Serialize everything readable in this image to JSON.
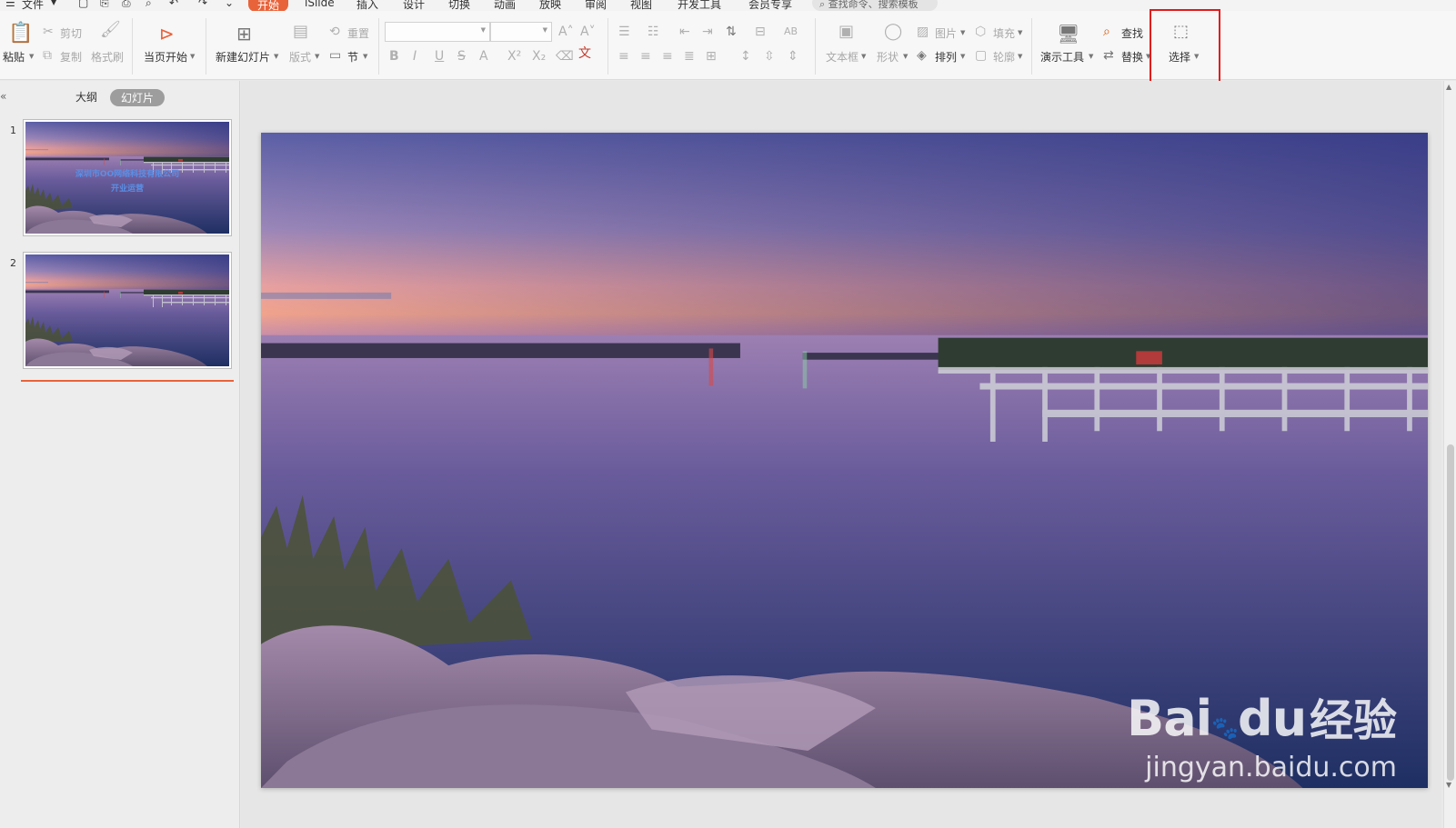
{
  "menu": {
    "file": "文件",
    "tabs": [
      "开始",
      "iSlide",
      "插入",
      "设计",
      "切换",
      "动画",
      "放映",
      "审阅",
      "视图",
      "开发工具",
      "会员专享"
    ],
    "active_tab": "开始",
    "search_placeholder": "查找命令、搜索模板"
  },
  "ribbon": {
    "paste": "粘贴",
    "cut": "剪切",
    "copy": "复制",
    "format_painter": "格式刷",
    "from_current": "当页开始",
    "new_slide": "新建幻灯片",
    "layout": "版式",
    "reset": "重置",
    "section": "节",
    "text_box": "文本框",
    "shape": "形状",
    "picture": "图片",
    "fill": "填充",
    "arrange": "排列",
    "outline": "轮廓",
    "presentation_tools": "演示工具",
    "find": "查找",
    "replace": "替换",
    "select": "选择"
  },
  "panel": {
    "tab_outline": "大纲",
    "tab_slides": "幻灯片",
    "active_tab": "幻灯片",
    "slides": [
      {
        "number": "1",
        "title_line1": "深圳市OO网络科技有限公司",
        "title_line2": "开业运营"
      },
      {
        "number": "2"
      }
    ]
  },
  "watermark": {
    "brand": "Bai",
    "brand_suffix": "du",
    "cn": "经验",
    "url": "jingyan.baidu.com"
  },
  "colors": {
    "accent": "#e8633a",
    "highlight": "#e21a1a",
    "thumb_title": "#5a8fe6"
  }
}
